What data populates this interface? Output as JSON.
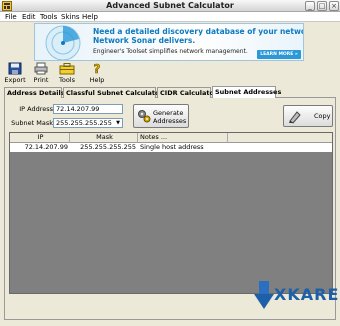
{
  "window": {
    "title": "Advanced Subnet Calculator"
  },
  "menu": [
    "File",
    "Edit",
    "Tools",
    "Skins",
    "Help"
  ],
  "banner": {
    "line1": "Need a detailed discovery database of your network?",
    "line2": "Network Sonar delivers.",
    "line3": "Engineer's Toolset simplifies network management.",
    "cta": "LEARN MORE »"
  },
  "toolbar": {
    "export": "Export",
    "print": "Print",
    "tools": "Tools",
    "help": "Help"
  },
  "tabs": [
    "Address Details",
    "Classful Subnet Calculator",
    "CIDR Calculator",
    "Subnet Addresses"
  ],
  "form": {
    "ip_label": "IP Address",
    "ip_value": "72.14.207.99",
    "mask_label": "Subnet Mask",
    "mask_value": "255.255.255.255",
    "generate_label": "Generate Addresses",
    "copy_label": "Copy"
  },
  "table": {
    "headers": [
      "IP",
      "Mask",
      "Notes ..."
    ],
    "rows": [
      {
        "ip": "72.14.207.99",
        "mask": "255.255.255.255",
        "notes": "Single host address"
      }
    ]
  },
  "watermark": "XKARE",
  "colors": {
    "banner_text": "#0f7abf",
    "table_bg": "#808080",
    "accent": "#2c98d8"
  }
}
